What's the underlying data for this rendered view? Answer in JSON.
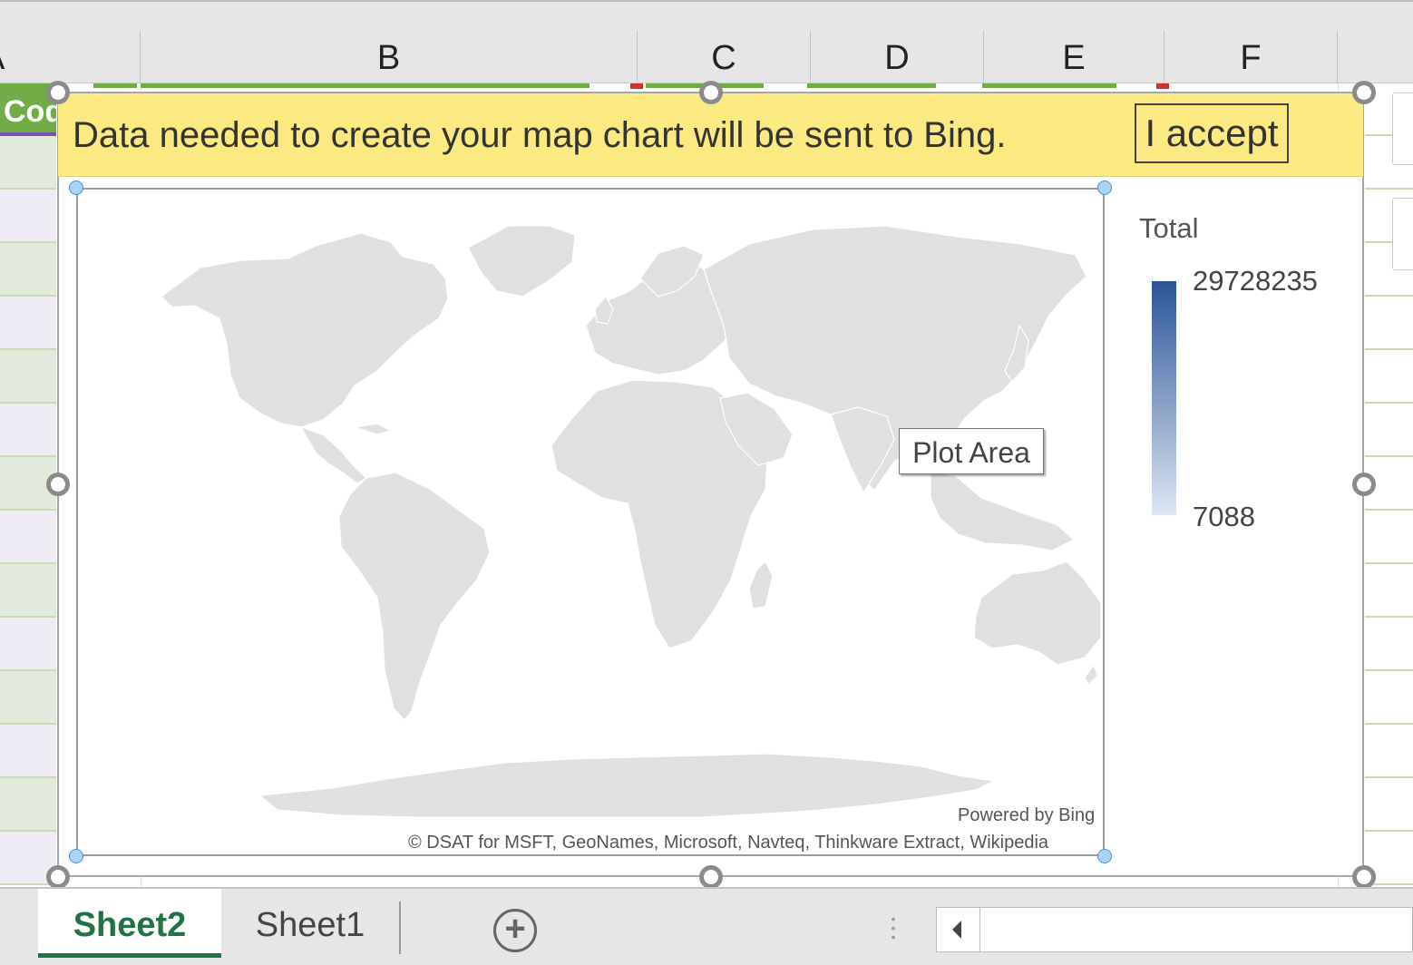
{
  "spreadsheet": {
    "columns": [
      "A",
      "B",
      "C",
      "D",
      "E",
      "F"
    ],
    "header_cell_text": "Code"
  },
  "chart": {
    "consent_message": "Data needed to create your map chart will be sent to Bing.",
    "accept_label": "I accept",
    "legend": {
      "title": "Total",
      "max": "29728235",
      "min": "7088",
      "color_high": "#2b5597",
      "color_low": "#dde6f4"
    },
    "tooltip": "Plot Area",
    "powered_by": "Powered by Bing",
    "copyright": "© DSAT for MSFT, GeoNames, Microsoft, Navteq, Thinkware Extract, Wikipedia",
    "map_fill_color": "#e0e0e0"
  },
  "sheets": {
    "tabs": [
      "Sheet2",
      "Sheet1"
    ],
    "active": "Sheet2"
  },
  "colors": {
    "excel_green": "#217346",
    "header_green": "#70ad47",
    "banner_yellow": "#fde982"
  }
}
